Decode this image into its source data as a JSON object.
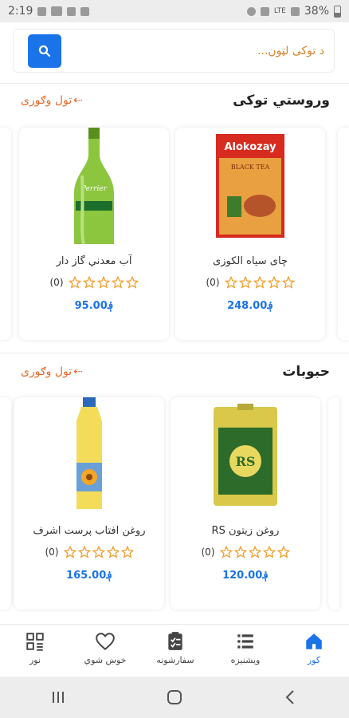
{
  "status_bar": {
    "time": "2:19",
    "battery": "38%",
    "network": "LTE"
  },
  "search": {
    "placeholder": "د توکی لټون..."
  },
  "sections": [
    {
      "title": "وروستي توکی",
      "see_all": "تول وګوری",
      "products": [
        {
          "name": "چای سیاه الکوزی",
          "rating_count": "(0)",
          "price": "248.00؋",
          "image": "alokozay-black-tea-box"
        },
        {
          "name": "آب معدني گاز دار",
          "rating_count": "(0)",
          "price": "95.00؋",
          "image": "perrier-green-bottle"
        }
      ]
    },
    {
      "title": "حبوبات",
      "see_all": "تول وګوری",
      "products": [
        {
          "name": "روغن زیتون RS",
          "rating_count": "(0)",
          "price": "120.00؋",
          "image": "rs-olive-oil-tin"
        },
        {
          "name": "روغن افتاب پرست اشرف",
          "rating_count": "(0)",
          "price": "165.00؋",
          "image": "sunflower-oil-bottle"
        }
      ]
    }
  ],
  "bottom_nav": [
    {
      "label": "کور",
      "icon": "home-icon",
      "active": true
    },
    {
      "label": "ویشنیزه",
      "icon": "list-icon",
      "active": false
    },
    {
      "label": "سفارشونه",
      "icon": "clipboard-icon",
      "active": false
    },
    {
      "label": "خوښ شوي",
      "icon": "heart-icon",
      "active": false
    },
    {
      "label": "نور",
      "icon": "grid-menu-icon",
      "active": false
    }
  ],
  "colors": {
    "accent_blue": "#1a73e8",
    "see_all_orange": "#e86a2c",
    "star_orange": "#f0a030"
  }
}
